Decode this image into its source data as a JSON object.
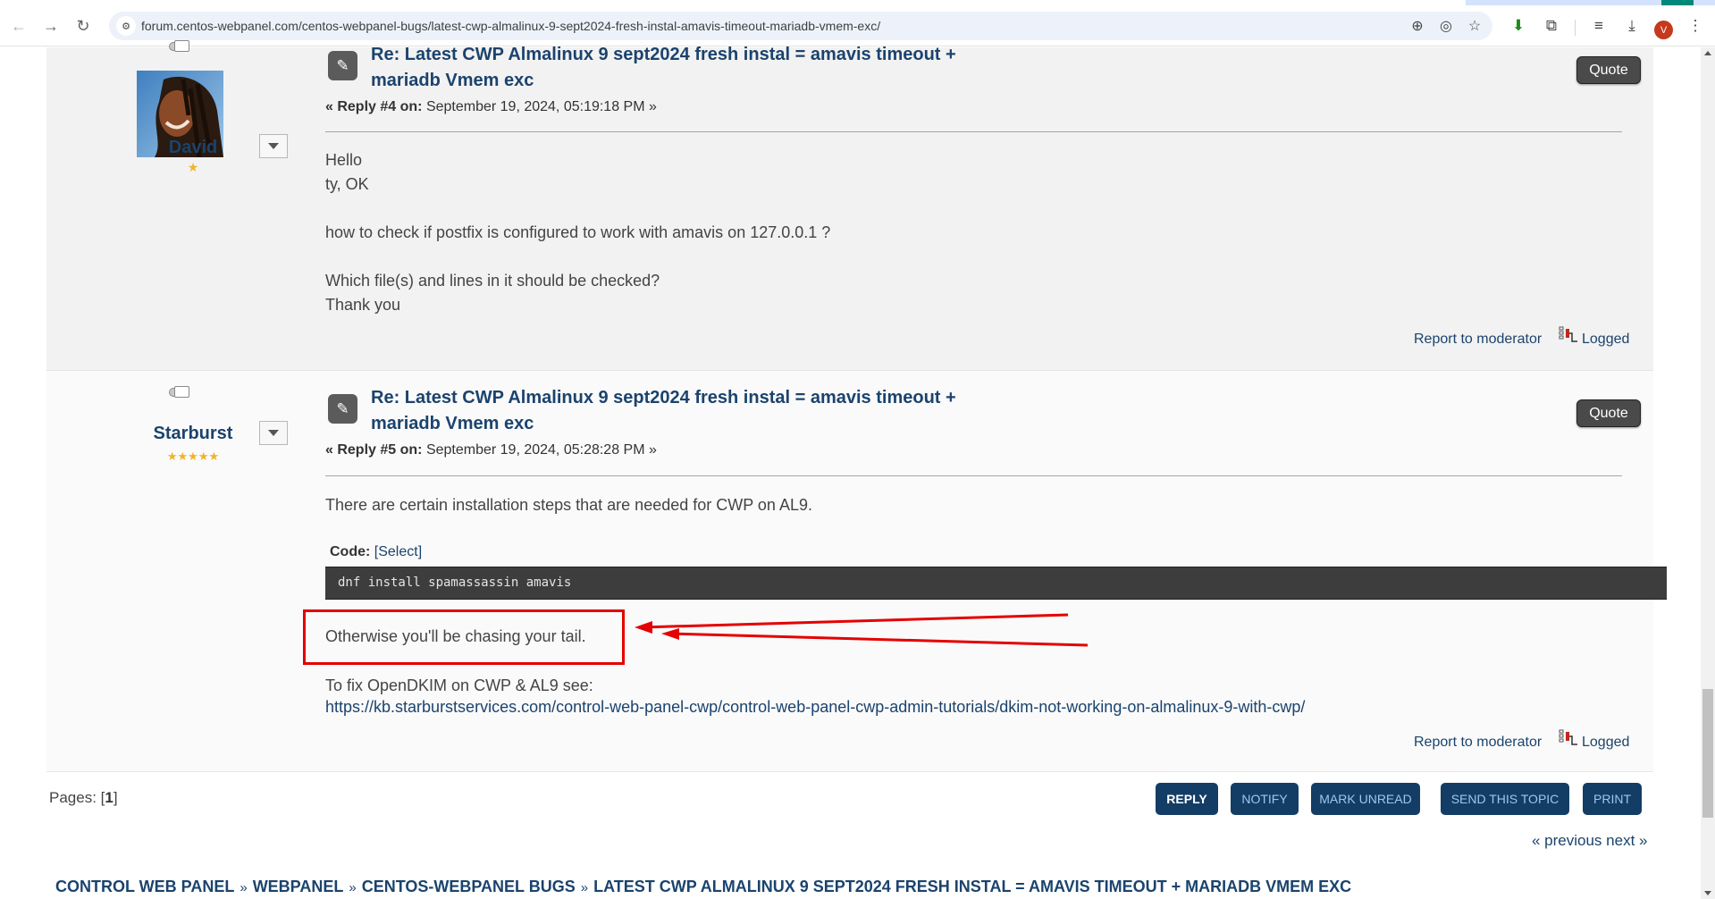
{
  "browser": {
    "url": "forum.centos-webpanel.com/centos-webpanel-bugs/latest-cwp-almalinux-9-sept2024-fresh-instal-amavis-timeout-mariadb-vmem-exc/",
    "profile_initial": "V",
    "icons": [
      "back-icon",
      "forward-icon",
      "reload-icon",
      "site-info-icon",
      "zoom-icon",
      "eye-off-icon",
      "star-icon",
      "download-arrow-extension-icon",
      "extensions-icon",
      "media-control-icon",
      "downloads-icon",
      "profile-avatar",
      "menu-icon"
    ]
  },
  "posts": [
    {
      "author": "David",
      "star_count": 1,
      "stars": "★",
      "has_avatar": true,
      "title": "Re: Latest CWP Almalinux 9 sept2024 fresh instal = amavis timeout + mariadb Vmem exc",
      "reply_label": "« Reply #4 on:",
      "reply_date": "September 19, 2024, 05:19:18 PM »",
      "quote_label": "Quote",
      "body_lines": [
        "Hello",
        "ty, OK",
        "",
        "how to check if postfix is configured to work with amavis on 127.0.0.1 ?",
        "",
        "Which file(s) and lines in it should be checked?",
        "Thank you"
      ],
      "report_label": "Report to moderator",
      "logged_label": "Logged"
    },
    {
      "author": "Starburst",
      "star_count": 5,
      "stars": "★★★★★",
      "has_avatar": false,
      "title": "Re: Latest CWP Almalinux 9 sept2024 fresh instal = amavis timeout + mariadb Vmem exc",
      "reply_label": "« Reply #5 on:",
      "reply_date": "September 19, 2024, 05:28:28 PM »",
      "quote_label": "Quote",
      "intro": "There are certain installation steps that are needed for CWP on AL9.",
      "code_label": "Code:",
      "code_select": "[Select]",
      "code": "dnf install spamassassin amavis",
      "highlighted_text": "Otherwise you'll be chasing your tail.",
      "dkim_text": "To fix OpenDKIM on CWP & AL9 see:",
      "dkim_link": "https://kb.starburstservices.com/control-web-panel-cwp/control-web-panel-cwp-admin-tutorials/dkim-not-working-on-almalinux-9-with-cwp/",
      "report_label": "Report to moderator",
      "logged_label": "Logged"
    }
  ],
  "annotation": {
    "color": "#e40000",
    "type": "red box with two arrows"
  },
  "footer": {
    "pages_label": "Pages:",
    "current_page": "1",
    "buttons": [
      "REPLY",
      "NOTIFY",
      "MARK UNREAD",
      "SEND THIS TOPIC",
      "PRINT"
    ],
    "prev_next": "« previous next »",
    "breadcrumb": [
      "CONTROL WEB PANEL",
      "WEBPANEL",
      "CENTOS-WEBPANEL BUGS",
      "LATEST CWP ALMALINUX 9 SEPT2024 FRESH INSTAL = AMAVIS TIMEOUT + MARIADB VMEM EXC"
    ],
    "breadcrumb_sep": "»"
  },
  "colors": {
    "link": "#1b436d",
    "button_bg": "#143d66",
    "star": "#f0b428"
  }
}
